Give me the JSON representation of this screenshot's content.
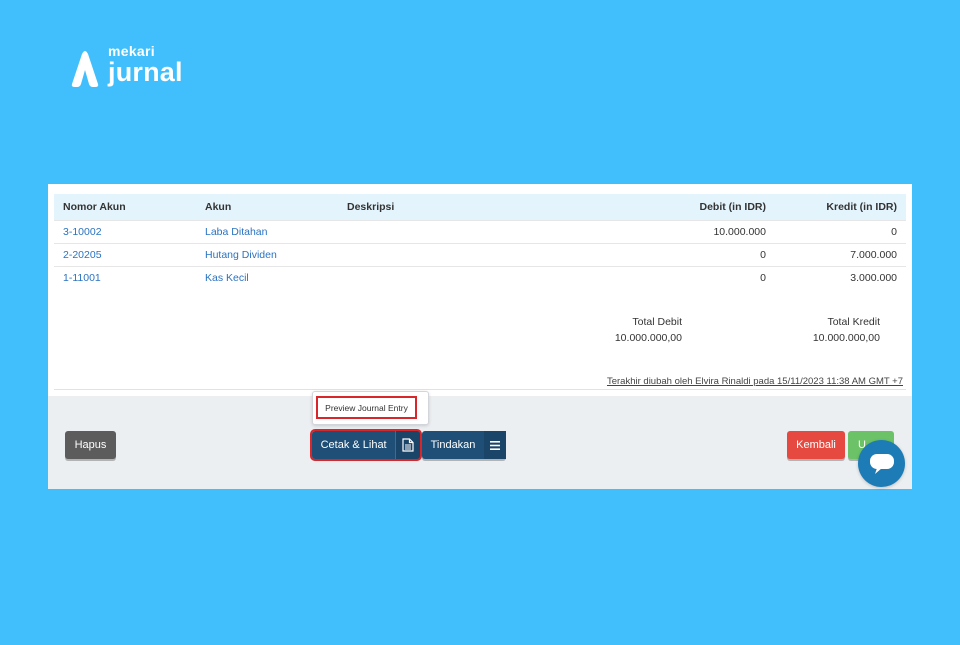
{
  "brand": {
    "small": "mekari",
    "big": "jurnal"
  },
  "table": {
    "headers": [
      "Nomor Akun",
      "Akun",
      "Deskripsi",
      "Debit (in IDR)",
      "Kredit (in IDR)"
    ],
    "rows": [
      {
        "nomor": "3-10002",
        "akun": "Laba Ditahan",
        "deskripsi": "",
        "debit": "10.000.000",
        "kredit": "0"
      },
      {
        "nomor": "2-20205",
        "akun": "Hutang Dividen",
        "deskripsi": "",
        "debit": "0",
        "kredit": "7.000.000"
      },
      {
        "nomor": "1-11001",
        "akun": "Kas Kecil",
        "deskripsi": "",
        "debit": "0",
        "kredit": "3.000.000"
      }
    ]
  },
  "totals": {
    "debit_label": "Total Debit",
    "debit_value": "10.000.000,00",
    "kredit_label": "Total Kredit",
    "kredit_value": "10.000.000,00"
  },
  "last_edit": "Terakhir diubah oleh Elvira Rinaldi pada 15/11/2023 11:38 AM GMT +7",
  "actions": {
    "hapus": "Hapus",
    "cetak": "Cetak & Lihat",
    "tindakan": "Tindakan",
    "kembali": "Kembali",
    "ubah": "U"
  },
  "dropdown": {
    "item": "Preview Journal Entry"
  },
  "colors": {
    "background": "#41bffc",
    "primary": "#1f4f76",
    "danger": "#e6493f",
    "success": "#6cc267",
    "highlight": "#d9262b"
  }
}
